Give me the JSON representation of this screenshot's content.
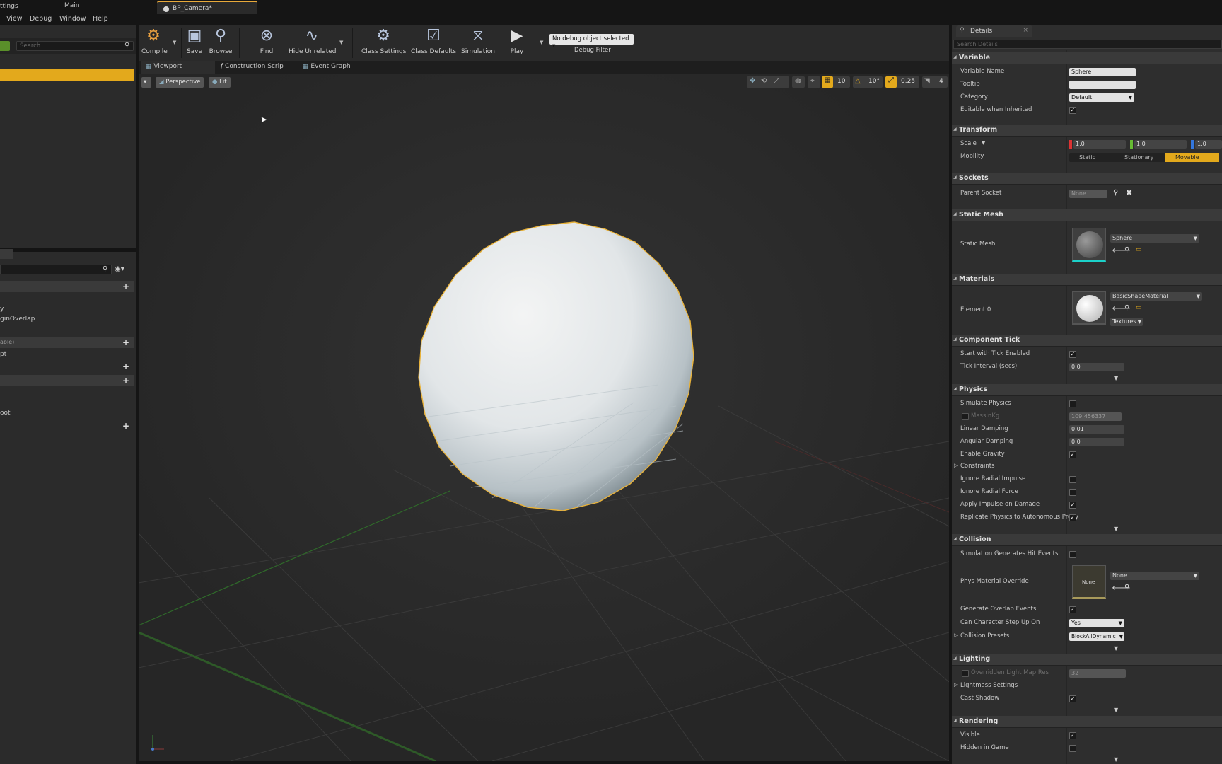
{
  "window": {
    "title_left": "ttings",
    "title_center": "Main",
    "doc_tab": "BP_Camera*"
  },
  "menu": [
    "View",
    "Debug",
    "Window",
    "Help"
  ],
  "left_panel": {
    "search_placeholder": "Search",
    "items": [
      "y",
      "ginOverlap",
      "able)",
      "pt",
      "oot"
    ]
  },
  "toolbar": {
    "compile": "Compile",
    "save": "Save",
    "browse": "Browse",
    "find": "Find",
    "hide_unrelated": "Hide Unrelated",
    "class_settings": "Class Settings",
    "class_defaults": "Class Defaults",
    "simulation": "Simulation",
    "play": "Play",
    "debug_object": "No debug object selected",
    "debug_filter": "Debug Filter"
  },
  "editor_tabs": [
    "Viewport",
    "Construction Scrip",
    "Event Graph"
  ],
  "viewport": {
    "perspective": "Perspective",
    "lit": "Lit",
    "grid_snap": "10",
    "rot_snap": "10°",
    "scale_snap": "0.25",
    "cam_speed": "4"
  },
  "details": {
    "tab": "Details",
    "search_placeholder": "Search Details",
    "variable": {
      "header": "Variable",
      "name_label": "Variable Name",
      "name_value": "Sphere",
      "tooltip_label": "Tooltip",
      "tooltip_value": "",
      "category_label": "Category",
      "category_value": "Default",
      "editable_label": "Editable when Inherited"
    },
    "transform": {
      "header": "Transform",
      "scale_label": "Scale",
      "scale_x": "1.0",
      "scale_y": "1.0",
      "scale_z": "1.0",
      "mobility_label": "Mobility",
      "mobility_options": [
        "Static",
        "Stationary",
        "Movable"
      ]
    },
    "sockets": {
      "header": "Sockets",
      "parent_label": "Parent Socket",
      "parent_value": "None"
    },
    "static_mesh": {
      "header": "Static Mesh",
      "label": "Static Mesh",
      "value": "Sphere"
    },
    "materials": {
      "header": "Materials",
      "element_label": "Element 0",
      "value": "BasicShapeMaterial",
      "textures": "Textures"
    },
    "component_tick": {
      "header": "Component Tick",
      "start_label": "Start with Tick Enabled",
      "interval_label": "Tick Interval (secs)",
      "interval_value": "0.0"
    },
    "physics": {
      "header": "Physics",
      "simulate": "Simulate Physics",
      "mass_label": "MassInKg",
      "mass_value": "109.456337",
      "linear_label": "Linear Damping",
      "linear_value": "0.01",
      "angular_label": "Angular Damping",
      "angular_value": "0.0",
      "gravity": "Enable Gravity",
      "constraints": "Constraints",
      "radial_impulse": "Ignore Radial Impulse",
      "radial_force": "Ignore Radial Force",
      "impulse_damage": "Apply Impulse on Damage",
      "replicate": "Replicate Physics to Autonomous Proxy"
    },
    "collision": {
      "header": "Collision",
      "sim_hit": "Simulation Generates Hit Events",
      "phys_mat_label": "Phys Material Override",
      "phys_mat_thumb": "None",
      "phys_mat_value": "None",
      "overlap": "Generate Overlap Events",
      "step_label": "Can Character Step Up On",
      "step_value": "Yes",
      "presets_label": "Collision Presets",
      "presets_value": "BlockAllDynamic"
    },
    "lighting": {
      "header": "Lighting",
      "override_label": "Overridden Light Map Res",
      "override_value": "32",
      "lightmass": "Lightmass Settings",
      "cast_shadow": "Cast Shadow"
    },
    "rendering": {
      "header": "Rendering",
      "visible": "Visible",
      "hidden": "Hidden in Game"
    }
  },
  "colors": {
    "accent_orange": "#e3a91c",
    "selection_outline": "#e8b23a",
    "mesh_thumb_underline": "#1bd1c9"
  }
}
